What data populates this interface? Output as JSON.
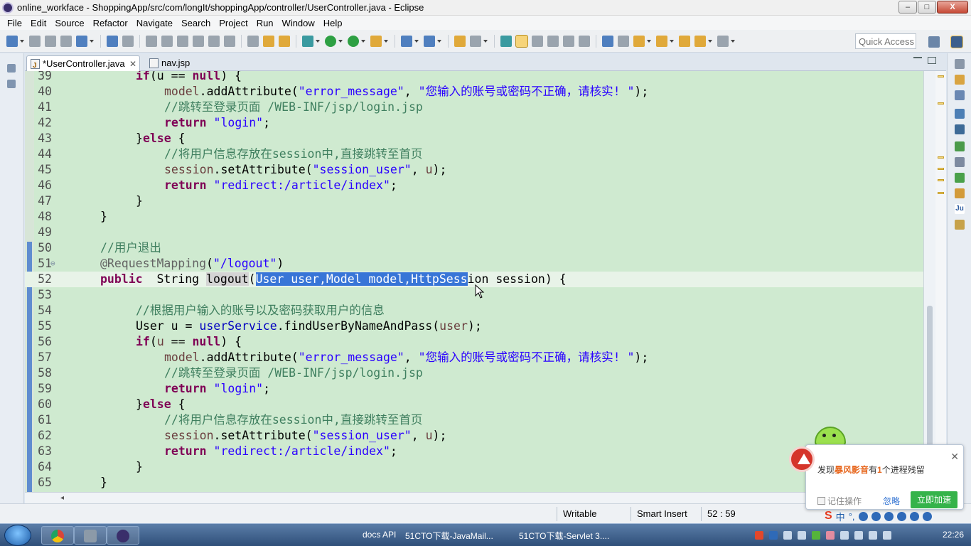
{
  "window": {
    "title": "online_workface - ShoppingApp/src/com/longIt/shoppingApp/controller/UserController.java - Eclipse",
    "buttons": [
      "–",
      "□",
      "X"
    ]
  },
  "menu": [
    "File",
    "Edit",
    "Source",
    "Refactor",
    "Navigate",
    "Search",
    "Project",
    "Run",
    "Window",
    "Help"
  ],
  "toolbar": {
    "quick_access": "Quick Access"
  },
  "tabs": [
    {
      "label": "*UserController.java",
      "active": true
    },
    {
      "label": "nav.jsp",
      "active": false
    }
  ],
  "editor": {
    "cursor_position": "52 : 59",
    "lines": [
      {
        "n": "39",
        "code": "if(u == null) {"
      },
      {
        "n": "40",
        "code": "model.addAttribute(\"error_message\", \"您输入的账号或密码不正确，请核实! \");"
      },
      {
        "n": "41",
        "code": "//跳转至登录页面 /WEB-INF/jsp/login.jsp"
      },
      {
        "n": "42",
        "code": "return \"login\";"
      },
      {
        "n": "43",
        "code": "}else {"
      },
      {
        "n": "44",
        "code": "//将用户信息存放在session中,直接跳转至首页"
      },
      {
        "n": "45",
        "code": "session.setAttribute(\"session_user\", u);"
      },
      {
        "n": "46",
        "code": "return \"redirect:/article/index\";"
      },
      {
        "n": "47",
        "code": "}"
      },
      {
        "n": "48",
        "code": "}"
      },
      {
        "n": "49",
        "code": ""
      },
      {
        "n": "50",
        "code": "//用户退出"
      },
      {
        "n": "51",
        "code": "@RequestMapping(\"/logout\")"
      },
      {
        "n": "52",
        "code": "public  String logout(User user,Model model,HttpSession session) {"
      },
      {
        "n": "53",
        "code": ""
      },
      {
        "n": "54",
        "code": "//根据用户输入的账号以及密码获取用户的信息"
      },
      {
        "n": "55",
        "code": "User u = userService.findUserByNameAndPass(user);"
      },
      {
        "n": "56",
        "code": "if(u == null) {"
      },
      {
        "n": "57",
        "code": "model.addAttribute(\"error_message\", \"您输入的账号或密码不正确，请核实! \");"
      },
      {
        "n": "58",
        "code": "//跳转至登录页面 /WEB-INF/jsp/login.jsp"
      },
      {
        "n": "59",
        "code": "return \"login\";"
      },
      {
        "n": "60",
        "code": "}else {"
      },
      {
        "n": "61",
        "code": "//将用户信息存放在session中,直接跳转至首页"
      },
      {
        "n": "62",
        "code": "session.setAttribute(\"session_user\", u);"
      },
      {
        "n": "63",
        "code": "return \"redirect:/article/index\";"
      },
      {
        "n": "64",
        "code": "}"
      },
      {
        "n": "65",
        "code": "}"
      }
    ]
  },
  "status": {
    "writable": "Writable",
    "insert_mode": "Smart Insert",
    "position": "52 : 59"
  },
  "popup": {
    "msg_prefix": "发现",
    "msg_app": "暴风影音",
    "msg_mid": "有",
    "msg_count": "1",
    "msg_suffix": "个进程残留",
    "remember": "记住操作",
    "ignore": "忽略",
    "speed_up": "立即加速"
  },
  "ime": {
    "lang": "中",
    "punct": "°,"
  },
  "taskbar": {
    "items": [
      "docs API",
      "51CTO下载-JavaMail...",
      "51CTO下载-Servlet 3...."
    ],
    "clock": "22:26"
  },
  "colors": {
    "editor_bg": "#cfead0",
    "selection": "#3875d7",
    "keyword": "#7f0055",
    "string": "#2a00ff",
    "comment": "#3f7f5f",
    "field": "#0000c0"
  }
}
